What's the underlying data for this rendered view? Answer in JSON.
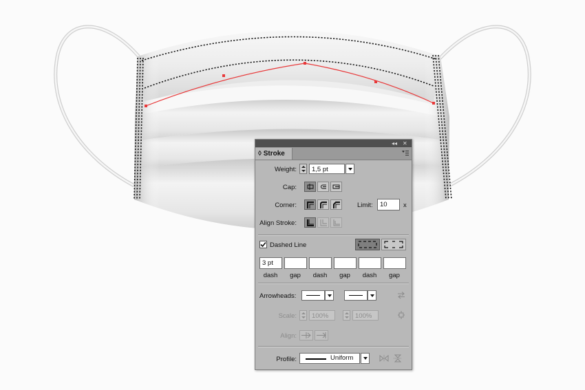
{
  "panel": {
    "tab_label": "Stroke",
    "tab_prefix": "◊",
    "collapse_glyph": "◂◂",
    "close_glyph": "✕",
    "weight_label": "Weight:",
    "weight_value": "1,5 pt",
    "cap_label": "Cap:",
    "corner_label": "Corner:",
    "limit_label": "Limit:",
    "limit_value": "10",
    "limit_unit": "x",
    "align_stroke_label": "Align Stroke:",
    "dashed_line_label": "Dashed Line",
    "dashed_checked": true,
    "dash_values": [
      "3 pt",
      "",
      "",
      "",
      "",
      ""
    ],
    "dash_labels": [
      "dash",
      "gap",
      "dash",
      "gap",
      "dash",
      "gap"
    ],
    "arrowheads_label": "Arrowheads:",
    "scale_label": "Scale:",
    "scale_start": "100%",
    "scale_end": "100%",
    "align_label": "Align:",
    "profile_label": "Profile:",
    "profile_value": "Uniform"
  },
  "colors": {
    "path_selection": "#e8393a",
    "dashed_stitch": "#1a1a1a",
    "panel_bg": "#b8b8b8",
    "titlebar": "#4f4f4f"
  }
}
